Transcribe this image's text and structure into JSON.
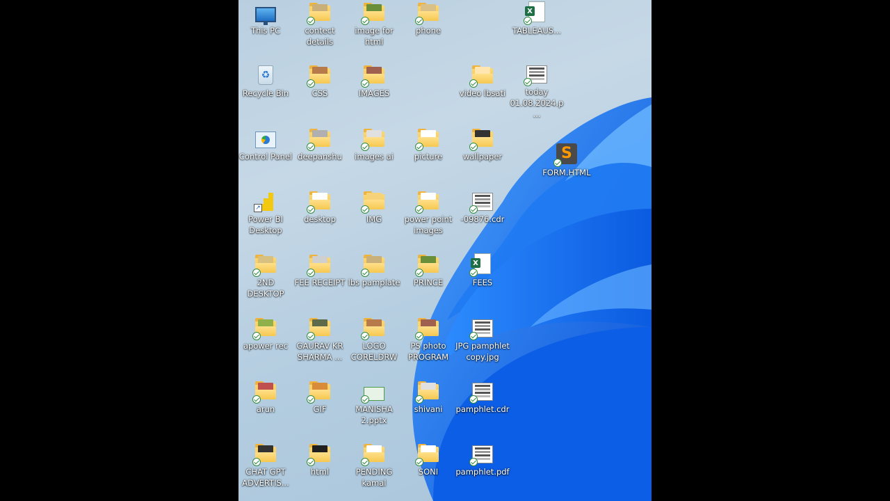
{
  "colors": {
    "letterbox": "#000000",
    "folder": "#f4c04a",
    "sync_check": "#2e8b3e",
    "excel": "#1d7044",
    "wallpaper_bloom": "#1a73f0"
  },
  "desktop": {
    "icons": [
      {
        "label": "This PC",
        "icon": "monitor-icon"
      },
      {
        "label": "contect\ndetails",
        "icon": "folder-icon"
      },
      {
        "label": "image for\nhtml",
        "icon": "folder-icon"
      },
      {
        "label": "phone",
        "icon": "folder-icon"
      },
      {
        "label": "TABLEAUS...",
        "icon": "excel-file-icon"
      },
      {
        "label": "Recycle Bin",
        "icon": "recycle-bin-icon"
      },
      {
        "label": "CSS",
        "icon": "folder-icon"
      },
      {
        "label": "IMAGES",
        "icon": "folder-icon"
      },
      {
        "label": "video lbsati",
        "icon": "folder-icon"
      },
      {
        "label": "today\n01.08.2024.p...",
        "icon": "image-file-icon"
      },
      {
        "label": "Control Panel",
        "icon": "control-panel-icon"
      },
      {
        "label": "deepanshu",
        "icon": "folder-icon"
      },
      {
        "label": "images ai",
        "icon": "folder-icon"
      },
      {
        "label": "picture",
        "icon": "folder-icon"
      },
      {
        "label": "wallpaper",
        "icon": "folder-icon"
      },
      {
        "label": "FORM.HTML",
        "icon": "sublime-file-icon"
      },
      {
        "label": "Power BI\nDesktop",
        "icon": "powerbi-icon"
      },
      {
        "label": "desktop",
        "icon": "folder-icon"
      },
      {
        "label": "IMG",
        "icon": "folder-icon"
      },
      {
        "label": "power point\nimages",
        "icon": "folder-icon"
      },
      {
        "label": "-09876.cdr",
        "icon": "image-file-icon"
      },
      {
        "label": "2ND\nDESKTOP",
        "icon": "folder-icon"
      },
      {
        "label": "FEE RECEIPT",
        "icon": "folder-icon"
      },
      {
        "label": "lbs pamplate",
        "icon": "folder-icon"
      },
      {
        "label": "PRINCE",
        "icon": "folder-icon"
      },
      {
        "label": "FEES",
        "icon": "excel-file-icon"
      },
      {
        "label": "apower rec",
        "icon": "folder-icon"
      },
      {
        "label": "GAURAV KR\nSHARMA ...",
        "icon": "folder-icon"
      },
      {
        "label": "LOGO\nCORELDRW",
        "icon": "folder-icon"
      },
      {
        "label": "PS photo\nPROGRAM",
        "icon": "folder-icon"
      },
      {
        "label": "JPG pamphlet\ncopy.jpg",
        "icon": "image-file-icon"
      },
      {
        "label": "arun",
        "icon": "folder-icon"
      },
      {
        "label": "GIF",
        "icon": "folder-icon"
      },
      {
        "label": "MANISHA\n2.pptx",
        "icon": "pptx-file-icon"
      },
      {
        "label": "shivani",
        "icon": "folder-icon"
      },
      {
        "label": "pamphlet.cdr",
        "icon": "image-file-icon"
      },
      {
        "label": "CHAT GPT\nADVERTIS...",
        "icon": "folder-icon"
      },
      {
        "label": "html",
        "icon": "folder-icon"
      },
      {
        "label": "PENDING\nkamal",
        "icon": "folder-icon"
      },
      {
        "label": "SONI",
        "icon": "folder-icon"
      },
      {
        "label": "pamphlet.pdf",
        "icon": "pdf-file-icon"
      }
    ]
  }
}
